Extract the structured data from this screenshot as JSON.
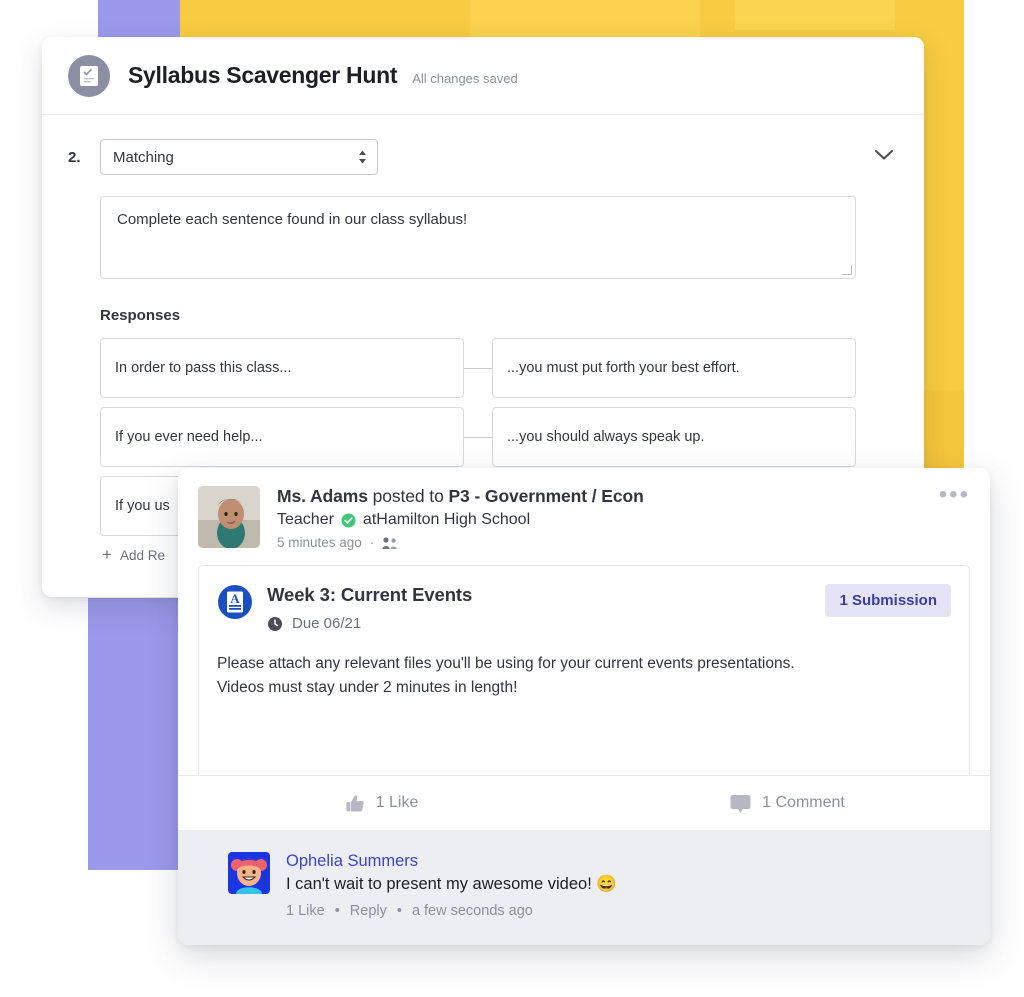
{
  "colors": {
    "purple": "#9a99ea",
    "yellow": "#f6c83c",
    "yellow_light": "#fbd34f",
    "accent_blue": "#3a46c8",
    "badge_bg": "#e4e4f6",
    "badge_text": "#3a3f9e",
    "verified_green": "#3fc87a",
    "comment_bg": "#eceef3"
  },
  "quiz": {
    "icon": "quiz-document-icon",
    "title": "Syllabus Scavenger Hunt",
    "save_status": "All changes saved",
    "question_number": "2.",
    "type_select": {
      "value": "Matching",
      "icon": "updown-arrows-icon"
    },
    "collapse_icon": "chevron-down-icon",
    "prompt": "Complete each sentence found in our class syllabus!",
    "responses_label": "Responses",
    "pairs": [
      {
        "left": "In order to pass this class...",
        "right": "...you must put forth your best effort."
      },
      {
        "left": "If you ever need help...",
        "right": "...you should always speak up."
      },
      {
        "left": "If you us",
        "right": ""
      }
    ],
    "add_response_label": "Add Re",
    "add_icon": "plus-icon"
  },
  "post": {
    "avatar": "teacher-avatar",
    "author": "Ms. Adams",
    "action_text": " posted to ",
    "target": "P3 - Government / Econ",
    "role": "Teacher",
    "verified_icon": "verified-badge-icon",
    "school_prefix": "at ",
    "school": "Hamilton High School",
    "timestamp": "5 minutes ago",
    "separator": "·",
    "audience_icon": "audience-group-icon",
    "menu_icon": "more-options-icon",
    "assignment": {
      "icon": "assignment-document-icon",
      "title": "Week 3: Current Events",
      "due_icon": "clock-icon",
      "due_label": "Due 06/21",
      "submission_badge": "1 Submission",
      "description_line1": "Please attach any relevant files you'll be using for your current events presentations.",
      "description_line2": "Videos must stay under 2 minutes in length!"
    },
    "actions": {
      "like_icon": "thumbs-up-icon",
      "like_label": "1 Like",
      "comment_icon": "comment-bubble-icon",
      "comment_label": "1 Comment"
    },
    "comment": {
      "avatar": "student-avatar",
      "author": "Ophelia Summers",
      "text": "I can't wait to present my awesome video! 😄",
      "like_label": "1 Like",
      "reply_label": "Reply",
      "time_label": "a few seconds ago",
      "dot": "•"
    }
  }
}
